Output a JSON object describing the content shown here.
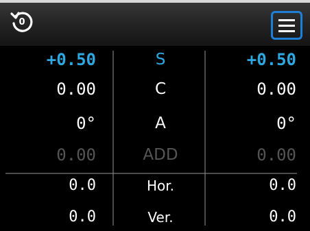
{
  "header": {
    "reset_counter": "0",
    "reset_icon": "reset-rotate-icon",
    "menu_icon": "hamburger-menu-icon",
    "accent_color": "#1e7fd6"
  },
  "rows": {
    "sphere": {
      "label": "S",
      "left": "+0.50",
      "right": "+0.50"
    },
    "cylinder": {
      "label": "C",
      "left": "0.00",
      "right": "0.00"
    },
    "axis": {
      "label": "A",
      "left": "0°",
      "right": "0°"
    },
    "addition": {
      "label": "ADD",
      "left": "0.00",
      "right": "0.00"
    },
    "horizontal": {
      "label": "Hor.",
      "left": "0.0",
      "right": "0.0"
    },
    "vertical": {
      "label": "Ver.",
      "left": "0.0",
      "right": "0.0"
    }
  },
  "colors": {
    "highlight": "#2ea8e0",
    "disabled": "#555555",
    "text": "#ffffff"
  }
}
